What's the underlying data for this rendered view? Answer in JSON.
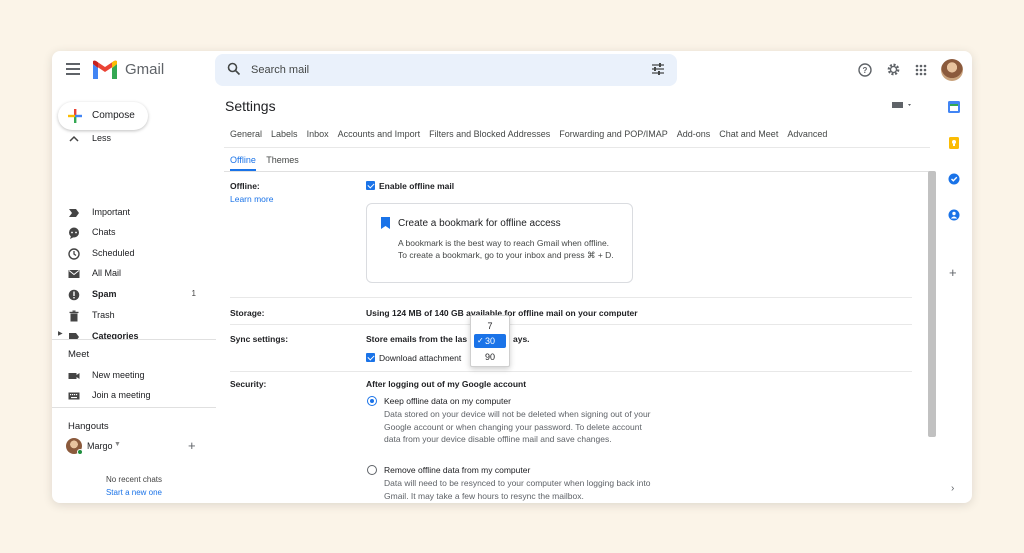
{
  "app": {
    "name": "Gmail"
  },
  "search": {
    "placeholder": "Search mail"
  },
  "compose": {
    "label": "Compose"
  },
  "sidebar": {
    "items": [
      {
        "label": "Less",
        "icon": "chevron-up-icon"
      },
      {
        "label": "Important",
        "icon": "important-icon"
      },
      {
        "label": "Chats",
        "icon": "chat-icon"
      },
      {
        "label": "Scheduled",
        "icon": "clock-icon"
      },
      {
        "label": "All Mail",
        "icon": "mail-icon"
      },
      {
        "label": "Spam",
        "icon": "spam-icon",
        "count": "1",
        "bold": true
      },
      {
        "label": "Trash",
        "icon": "trash-icon"
      },
      {
        "label": "Categories",
        "icon": "label-icon",
        "bold": true
      }
    ],
    "meet": {
      "heading": "Meet",
      "items": [
        {
          "label": "New meeting",
          "icon": "video-icon"
        },
        {
          "label": "Join a meeting",
          "icon": "keyboard-icon"
        }
      ]
    },
    "hangouts": {
      "heading": "Hangouts",
      "user": "Margo",
      "no_chats": "No recent chats",
      "start_new": "Start a new one"
    }
  },
  "settings": {
    "title": "Settings",
    "tabs_row1": [
      "General",
      "Labels",
      "Inbox",
      "Accounts and Import",
      "Filters and Blocked Addresses",
      "Forwarding and POP/IMAP",
      "Add-ons",
      "Chat and Meet",
      "Advanced"
    ],
    "tabs_row2": [
      "Offline",
      "Themes"
    ],
    "active_tab": "Offline",
    "offline": {
      "label": "Offline:",
      "learn_more": "Learn more",
      "enable_label": "Enable offline mail",
      "card_title": "Create a bookmark for offline access",
      "card_body": "A bookmark is the best way to reach Gmail when offline. To create a bookmark, go to your inbox and press ⌘ + D."
    },
    "storage": {
      "label": "Storage:",
      "text": "Using 124 MB of 140 GB available for offline mail on your computer"
    },
    "sync": {
      "label": "Sync settings:",
      "text_before": "Store emails from the las",
      "text_after": "ays.",
      "download_label": "Download attachment",
      "dropdown_options": [
        "7",
        "30",
        "90"
      ],
      "selected": "30"
    },
    "security": {
      "label": "Security:",
      "heading": "After logging out of my Google account",
      "keep_label": "Keep offline data on my computer",
      "keep_desc": "Data stored on your device will not be deleted when signing out of your Google account or when changing your password. To delete account data from your device disable offline mail and save changes.",
      "remove_label": "Remove offline data from my computer",
      "remove_desc": "Data will need to be resynced to your computer when logging back into Gmail. It may take a few hours to resync the mailbox."
    }
  },
  "colors": {
    "accent": "#1a73e8",
    "page_bg": "#fbf4e8",
    "search_bg": "#eaf1fb"
  }
}
